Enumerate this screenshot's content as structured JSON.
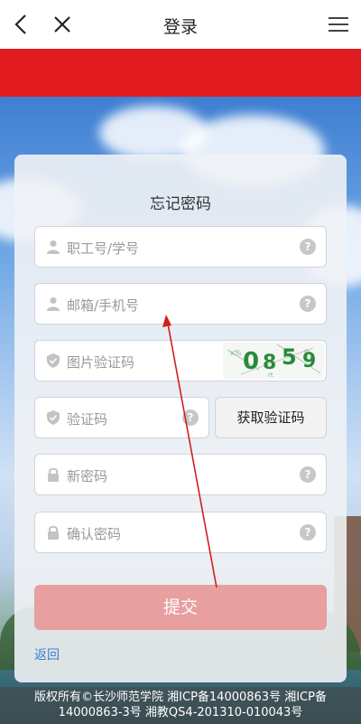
{
  "header": {
    "title": "登录"
  },
  "form": {
    "title": "忘记密码",
    "fields": [
      {
        "placeholder": "职工号/学号",
        "icon": "user-icon"
      },
      {
        "placeholder": "邮箱/手机号",
        "icon": "user-icon"
      },
      {
        "placeholder": "图片验证码",
        "icon": "shield-icon",
        "captcha": [
          "0",
          "8",
          "5",
          "9"
        ]
      },
      {
        "placeholder": "验证码",
        "icon": "shield-icon"
      },
      {
        "placeholder": "新密码",
        "icon": "lock-icon"
      },
      {
        "placeholder": "确认密码",
        "icon": "lock-icon"
      }
    ],
    "get_code_label": "获取验证码",
    "submit_label": "提交",
    "back_label": "返回",
    "help_glyph": "?"
  },
  "footer": {
    "line1": "版权所有©长沙师范学院 湘ICP备14000863号 湘ICP备",
    "line2": "14000863-3号 湘教QS4-201310-010043号"
  },
  "colors": {
    "brand_red": "#e11a1f",
    "submit_disabled": "#e79f9f",
    "link_blue": "#3a7fd5",
    "annotation_red": "#d11f1f"
  }
}
